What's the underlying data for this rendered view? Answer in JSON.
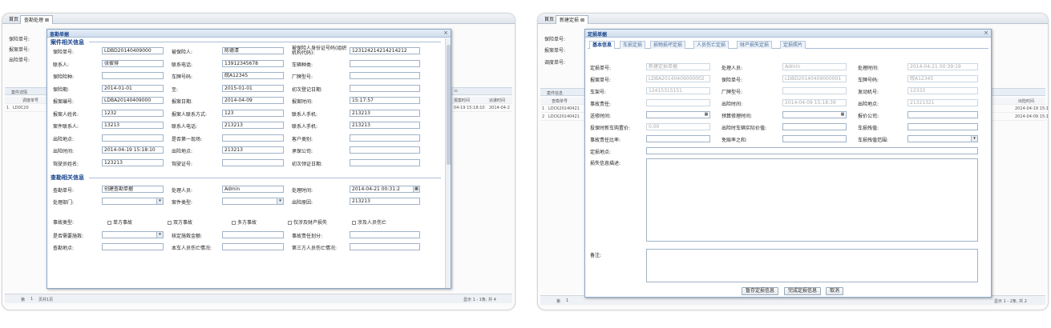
{
  "left": {
    "tabs": {
      "home": "首页",
      "active": "查勘处理"
    },
    "bg": {
      "labels": [
        "保险单号:",
        "报案单号:",
        "出险单号:"
      ],
      "strip_label": "案件详情",
      "col_label": "调度单号",
      "row_id": "1",
      "row_code": "LD0C20",
      "col_time1": "报案时间",
      "col_time2": "派遣时间",
      "row_time1": "04-19 15:18:10",
      "row_time2": "2014-04-2",
      "pager": {
        "first": "第",
        "page": "1",
        "of": "页共1页",
        "summary": "显示 1 - 1条, 共 4"
      }
    },
    "dialog": {
      "title": "查勘单据",
      "close": "×",
      "section1": "案件相关信息",
      "fields1": [
        {
          "l1": "保险单号:",
          "v1": "LDBD20140409000",
          "l2": "被保险人:",
          "v2": "陈德清",
          "l3": "被保险人身份证号码(组织机构代码):",
          "v3": "123124214214214212"
        },
        {
          "l1": "联系人:",
          "v1": "张彼得",
          "l2": "联系电话:",
          "v2": "13912345678",
          "l3": "车辆种类:",
          "v3": ""
        },
        {
          "l1": "保险险种:",
          "v1": "",
          "l2": "车牌号码:",
          "v2": "皖A12345",
          "l3": "厂牌型号:",
          "v3": ""
        },
        {
          "l1": "保险期:",
          "v1": "2014-01-01",
          "l2": "至:",
          "v2": "2015-01-01",
          "l3": "初次登记日期:",
          "v3": ""
        },
        {
          "l1": "报案编号:",
          "v1": "LDBA20140409000",
          "l2": "报案日期:",
          "v2": "2014-04-09",
          "l3": "报案时间:",
          "v3": "15:17:57"
        },
        {
          "l1": "报案人姓名:",
          "v1": "1232",
          "l2": "报案人联系方式:",
          "v2": "123",
          "l3": "联系人手机:",
          "v3": "213213"
        },
        {
          "l1": "案件联系人:",
          "v1": "13213",
          "l2": "联系人电话:",
          "v2": "213213",
          "l3": "联系人手机:",
          "v3": "213213"
        },
        {
          "l1": "出险地点:",
          "v1": "",
          "l2": "是否第一现场:",
          "v2": "",
          "l3": "客户类别:",
          "v3": ""
        },
        {
          "l1": "出险时间:",
          "v1": "2014-04-19 15:18:10",
          "l2": "出险地点:",
          "v2": "213213",
          "l3": "承保公司:",
          "v3": ""
        },
        {
          "l1": "驾驶员姓名:",
          "v1": "123213",
          "l2": "驾驶证号:",
          "v2": "",
          "l3": "初次领证日期:",
          "v3": ""
        }
      ],
      "section2": "查勘相关信息",
      "fields2": [
        {
          "l1": "查勘单号:",
          "v1": "创建查勘单据",
          "l2": "处理人员:",
          "v2": "Admin",
          "l3": "处理时间:",
          "v3": "2014-04-21 00:31:2"
        },
        {
          "l1": "处理部门:",
          "v1": "",
          "l2": "案件类型:",
          "v2": "",
          "l3": "出险原因:",
          "v3": "213213"
        }
      ],
      "checks_label": "事故类型:",
      "checks": [
        "单方事故",
        "双方事故",
        "多方事故",
        "仅涉及财产损失",
        "涉及人员伤亡"
      ],
      "fields3": [
        {
          "l1": "是否需要施救:",
          "l2": "核定施救金额:",
          "l3": "事故责任划分:"
        },
        {
          "l1": "查勘地点:",
          "l2": "本车人员伤亡情况:",
          "l3": "第三方人员伤亡情况:"
        }
      ],
      "scroll_mark": "≡"
    }
  },
  "right": {
    "tabs": {
      "home": "首页",
      "active": "新建定损"
    },
    "bg": {
      "labels": [
        "保险单号:",
        "报案单号:",
        "调度单号:"
      ],
      "strip_label": "案件信息",
      "col_label": "查勘单号",
      "rows": [
        {
          "id": "1",
          "code": "LDCK20140421"
        },
        {
          "id": "2",
          "code": "LDCK20140421"
        }
      ],
      "col_time": "出险时间",
      "row_times": [
        "2014-04-19 15:1",
        "2014-04-09 15:1"
      ],
      "pager": {
        "first": "第",
        "page": "1",
        "summary": "显示 1 - 2条, 共 2"
      }
    },
    "dialog": {
      "title": "定损单据",
      "close": "×",
      "tabs": [
        "基本信息",
        "车损定损",
        "损物损坏定损",
        "人员伤亡定损",
        "财产损失定损",
        "定损照片"
      ],
      "fields": [
        {
          "l1": "定损单号:",
          "v1": "新建定损单据",
          "l2": "处理人员:",
          "v2": "Admin",
          "l3": "处理时间:",
          "v3": "2014-04-21 00:39:19"
        },
        {
          "l1": "报案单号:",
          "v1": "LDBA20140409000002",
          "l2": "保险单号:",
          "v2": "LDBD20140409000001",
          "l3": "车牌号码:",
          "v3": "皖A12345"
        },
        {
          "l1": "车架号:",
          "v1": "12415315151",
          "l2": "厂牌型号:",
          "v2": "",
          "l3": "发动机号:",
          "v3": "12333"
        },
        {
          "l1": "事故责任:",
          "v1": "",
          "l2": "出险时间:",
          "v2": "2014-04-09 15:18:39",
          "l3": "出险地点:",
          "v3": "21321321"
        }
      ],
      "row5": {
        "l1": "送修时间:",
        "l2": "预算修理时间:",
        "l3": "报价公司:"
      },
      "row6": {
        "l1": "投保时新车购置价:",
        "v1": "0.00",
        "l2": "出险时车辆实际价值:",
        "l3": "车损残值:"
      },
      "row7": {
        "l1": "事故责任比率:",
        "l2": "免赔率之和:",
        "l3": "车损残值范围:"
      },
      "place_label": "定损地点:",
      "desc_label": "损失信息描述:",
      "remark_label": "备注:",
      "buttons": [
        "暂存定损信息",
        "完成定损信息",
        "取消"
      ]
    }
  }
}
